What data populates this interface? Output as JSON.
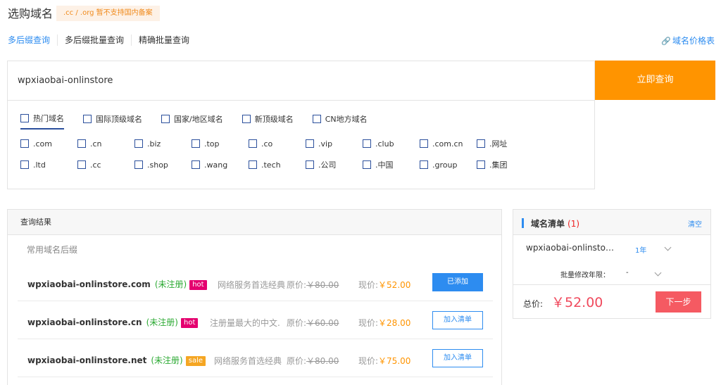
{
  "header": {
    "title": "选购域名",
    "notice": ".cc / .org 暂不支持国内备案"
  },
  "tabs": [
    {
      "label": "多后缀查询"
    },
    {
      "label": "多后缀批量查询"
    },
    {
      "label": "精确批量查询"
    }
  ],
  "price_link": "域名价格表",
  "search": {
    "value": "wpxiaobai-onlinstore",
    "button": "立即查询"
  },
  "categories": [
    {
      "label": "热门域名"
    },
    {
      "label": "国际顶级域名"
    },
    {
      "label": "国家/地区域名"
    },
    {
      "label": "新顶级域名"
    },
    {
      "label": "CN地方域名"
    }
  ],
  "tlds": [
    ".com",
    ".cn",
    ".biz",
    ".top",
    ".co",
    ".vip",
    ".club",
    ".com.cn",
    ".网址",
    ".ltd",
    ".cc",
    ".shop",
    ".wang",
    ".tech",
    ".公司",
    ".中国",
    ".group",
    ".集团"
  ],
  "results": {
    "header": "查询结果",
    "subheader": "常用域名后缀",
    "rows": [
      {
        "domain": "wpxiaobai-onlinstore.com",
        "status": "(未注册)",
        "badge": "hot",
        "desc": "网络服务首选经典",
        "orig_label": "原价:",
        "orig_price": "￥80.00",
        "now_label": "现价:",
        "now_price": "￥52.00",
        "action": "已添加"
      },
      {
        "domain": "wpxiaobai-onlinstore.cn",
        "status": "(未注册)",
        "badge": "hot",
        "desc": "注册量最大的中文.",
        "orig_label": "原价:",
        "orig_price": "￥60.00",
        "now_label": "现价:",
        "now_price": "￥28.00",
        "action": "加入清单"
      },
      {
        "domain": "wpxiaobai-onlinstore.net",
        "status": "(未注册)",
        "badge": "sale",
        "desc": "网络服务首选经典",
        "orig_label": "原价:",
        "orig_price": "￥80.00",
        "now_label": "现价:",
        "now_price": "￥75.00",
        "action": "加入清单"
      }
    ]
  },
  "cart": {
    "title": "域名清单",
    "count": "(1)",
    "clear": "清空",
    "item": "wpxiaobai-onlinstore.com",
    "year": "1年",
    "batch_label": "批量修改年限：",
    "batch_value": "-",
    "total_label": "总价:",
    "total": "￥52.00",
    "next": "下一步"
  },
  "colors": {
    "accent": "#2d8cf0",
    "search_button": "#ff9400",
    "next_button": "#f55a62",
    "hot_badge": "#e4006f",
    "sale_badge": "#f5a623"
  }
}
